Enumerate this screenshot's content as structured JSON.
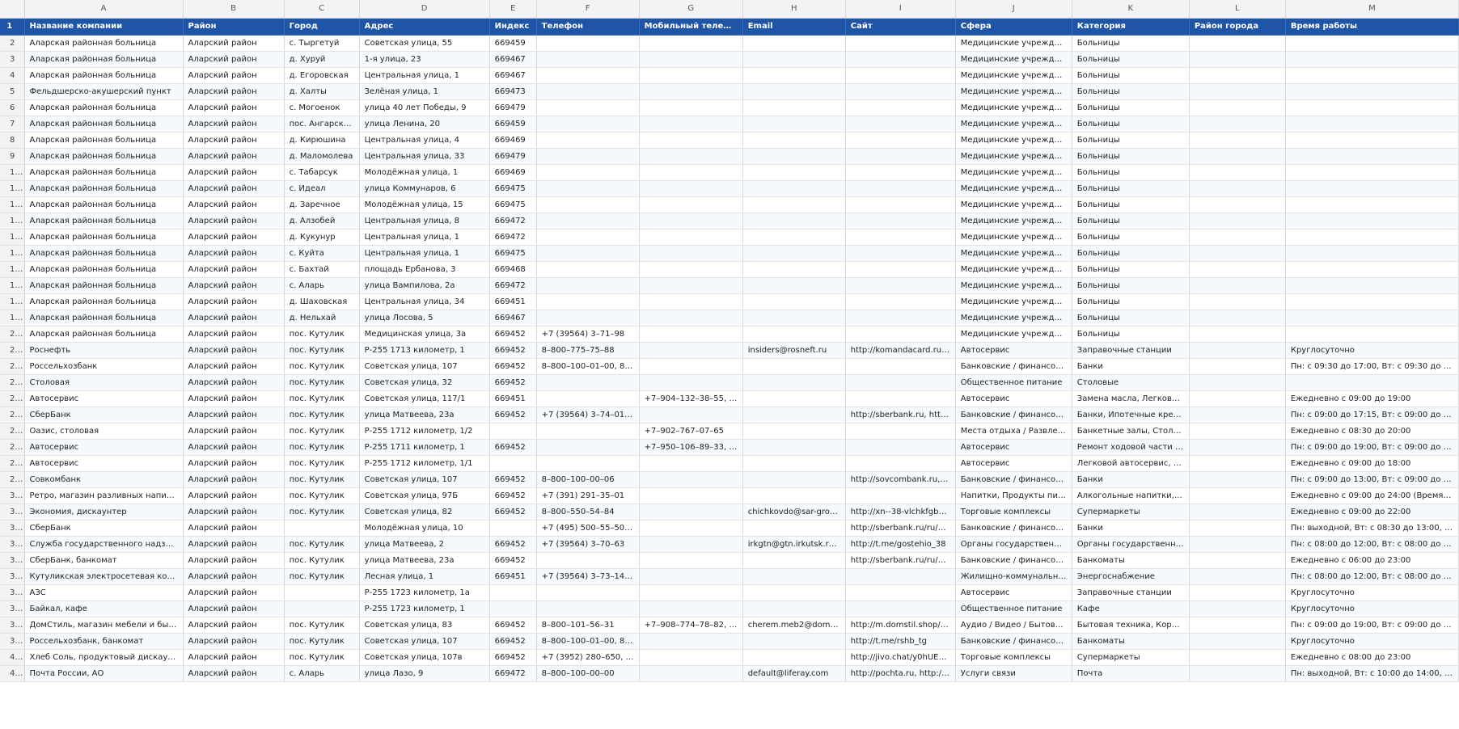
{
  "column_letters": [
    "A",
    "B",
    "C",
    "D",
    "E",
    "F",
    "G",
    "H",
    "I",
    "J",
    "K",
    "L",
    "M"
  ],
  "header_row_number": "1",
  "headers": [
    "Название компании",
    "Район",
    "Город",
    "Адрес",
    "Индекс",
    "Телефон",
    "Мобильный телефон",
    "Email",
    "Сайт",
    "Сфера",
    "Категория",
    "Район города",
    "Время работы"
  ],
  "rows": [
    [
      "2",
      "Аларская районная больница",
      "Аларский район",
      "с. Тыргетуй",
      "Советская улица, 55",
      "669459",
      "",
      "",
      "",
      "",
      "Медицинские учреждения",
      "Больницы",
      "",
      ""
    ],
    [
      "3",
      "Аларская районная больница",
      "Аларский район",
      "д. Хуруй",
      "1-я улица, 23",
      "669467",
      "",
      "",
      "",
      "",
      "Медицинские учреждения",
      "Больницы",
      "",
      ""
    ],
    [
      "4",
      "Аларская районная больница",
      "Аларский район",
      "д. Егоровская",
      "Центральная улица, 1",
      "669467",
      "",
      "",
      "",
      "",
      "Медицинские учреждения",
      "Больницы",
      "",
      ""
    ],
    [
      "5",
      "Фельдшерско-акушерский пункт",
      "Аларский район",
      "д. Халты",
      "Зелёная улица, 1",
      "669473",
      "",
      "",
      "",
      "",
      "Медицинские учреждения",
      "Больницы",
      "",
      ""
    ],
    [
      "6",
      "Аларская районная больница",
      "Аларский район",
      "с. Могоенок",
      "улица 40 лет Победы, 9",
      "669479",
      "",
      "",
      "",
      "",
      "Медицинские учреждения",
      "Больницы",
      "",
      ""
    ],
    [
      "7",
      "Аларская районная больница",
      "Аларский район",
      "пос. Ангарский",
      "улица Ленина, 20",
      "669459",
      "",
      "",
      "",
      "",
      "Медицинские учреждения",
      "Больницы",
      "",
      ""
    ],
    [
      "8",
      "Аларская районная больница",
      "Аларский район",
      "д. Кирюшина",
      "Центральная улица, 4",
      "669469",
      "",
      "",
      "",
      "",
      "Медицинские учреждения",
      "Больницы",
      "",
      ""
    ],
    [
      "9",
      "Аларская районная больница",
      "Аларский район",
      "д. Маломолева",
      "Центральная улица, 33",
      "669479",
      "",
      "",
      "",
      "",
      "Медицинские учреждения",
      "Больницы",
      "",
      ""
    ],
    [
      "10",
      "Аларская районная больница",
      "Аларский район",
      "с. Табарсук",
      "Молодёжная улица, 1",
      "669469",
      "",
      "",
      "",
      "",
      "Медицинские учреждения",
      "Больницы",
      "",
      ""
    ],
    [
      "11",
      "Аларская районная больница",
      "Аларский район",
      "с. Идеал",
      "улица Коммунаров, 6",
      "669475",
      "",
      "",
      "",
      "",
      "Медицинские учреждения",
      "Больницы",
      "",
      ""
    ],
    [
      "12",
      "Аларская районная больница",
      "Аларский район",
      "д. Заречное",
      "Молодёжная улица, 15",
      "669475",
      "",
      "",
      "",
      "",
      "Медицинские учреждения",
      "Больницы",
      "",
      ""
    ],
    [
      "13",
      "Аларская районная больница",
      "Аларский район",
      "д. Алзобей",
      "Центральная улица, 8",
      "669472",
      "",
      "",
      "",
      "",
      "Медицинские учреждения",
      "Больницы",
      "",
      ""
    ],
    [
      "14",
      "Аларская районная больница",
      "Аларский район",
      "д. Кукунур",
      "Центральная улица, 1",
      "669472",
      "",
      "",
      "",
      "",
      "Медицинские учреждения",
      "Больницы",
      "",
      ""
    ],
    [
      "15",
      "Аларская районная больница",
      "Аларский район",
      "с. Куйта",
      "Центральная улица, 1",
      "669475",
      "",
      "",
      "",
      "",
      "Медицинские учреждения",
      "Больницы",
      "",
      ""
    ],
    [
      "16",
      "Аларская районная больница",
      "Аларский район",
      "с. Бахтай",
      "площадь Ербанова, 3",
      "669468",
      "",
      "",
      "",
      "",
      "Медицинские учреждения",
      "Больницы",
      "",
      ""
    ],
    [
      "17",
      "Аларская районная больница",
      "Аларский район",
      "с. Аларь",
      "улица Вампилова, 2а",
      "669472",
      "",
      "",
      "",
      "",
      "Медицинские учреждения",
      "Больницы",
      "",
      ""
    ],
    [
      "18",
      "Аларская районная больница",
      "Аларский район",
      "д. Шаховская",
      "Центральная улица, 34",
      "669451",
      "",
      "",
      "",
      "",
      "Медицинские учреждения",
      "Больницы",
      "",
      ""
    ],
    [
      "19",
      "Аларская районная больница",
      "Аларский район",
      "д. Нельхай",
      "улица Лосова, 5",
      "669467",
      "",
      "",
      "",
      "",
      "Медицинские учреждения",
      "Больницы",
      "",
      ""
    ],
    [
      "20",
      "Аларская районная больница",
      "Аларский район",
      "пос. Кутулик",
      "Медицинская улица, 3а",
      "669452",
      "+7 (39564) 3–71–98",
      "",
      "",
      "",
      "Медицинские учреждения",
      "Больницы",
      "",
      ""
    ],
    [
      "21",
      "Роснефть",
      "Аларский район",
      "пос. Кутулик",
      "Р-255 1713 километр, 1",
      "669452",
      "8–800–775–75–88",
      "",
      "insiders@rosneft.ru",
      "http://komandacard.ru, ht...",
      "Автосервис",
      "Заправочные станции",
      "",
      "Круглосуточно"
    ],
    [
      "22",
      "Россельхозбанк",
      "Аларский район",
      "пос. Кутулик",
      "Советская улица, 107",
      "669452",
      "8–800–100–01–00, 8–8...",
      "",
      "",
      "",
      "Банковские / финансовые ...",
      "Банки",
      "",
      "Пн: с 09:30 до 17:00, Вт: с 09:30 до 17:00, С..."
    ],
    [
      "23",
      "Столовая",
      "Аларский район",
      "пос. Кутулик",
      "Советская улица, 32",
      "669452",
      "",
      "",
      "",
      "",
      "Общественное питание",
      "Столовые",
      "",
      ""
    ],
    [
      "24",
      "Автосервис",
      "Аларский район",
      "пос. Кутулик",
      "Советская улица, 117/1",
      "669451",
      "",
      "+7–904–132–38–55, +7...",
      "",
      "",
      "Автосервис",
      "Замена масла, Легковой а...",
      "",
      "Ежедневно с 09:00 до 19:00"
    ],
    [
      "25",
      "СберБанк",
      "Аларский район",
      "пос. Кутулик",
      "улица Матвеева, 23а",
      "669452",
      "+7 (39564) 3–74–01, 03...",
      "",
      "",
      "http://sberbank.ru, http://...",
      "Банковские / финансовые ...",
      "Банки, Ипотечные кредит...",
      "",
      "Пн: с 09:00 до 17:15, Вт: с 09:00 до 17:15, С..."
    ],
    [
      "26",
      "Оазис, столовая",
      "Аларский район",
      "пос. Кутулик",
      "Р-255 1712 километр, 1/2",
      "",
      "",
      "+7–902–767–07–65",
      "",
      "",
      "Места отдыха / Развлекате...",
      "Банкетные залы, Столовые",
      "",
      "Ежедневно с 08:30 до 20:00"
    ],
    [
      "27",
      "Автосервис",
      "Аларский район",
      "пос. Кутулик",
      "Р-255 1711 километр, 1",
      "669452",
      "",
      "+7–950–106–89–33, +7...",
      "",
      "",
      "Автосервис",
      "Ремонт ходовой части авт...",
      "",
      "Пн: с 09:00 до 19:00, Вт: с 09:00 до 19:00, С..."
    ],
    [
      "28",
      "Автосервис",
      "Аларский район",
      "пос. Кутулик",
      "Р-255 1712 километр, 1/1",
      "",
      "",
      "",
      "",
      "",
      "Автосервис",
      "Легковой автосервис, Рем...",
      "",
      "Ежедневно с 09:00 до 18:00"
    ],
    [
      "29",
      "Совкомбанк",
      "Аларский район",
      "пос. Кутулик",
      "Советская улица, 107",
      "669452",
      "8–800–100–00–06",
      "",
      "",
      "http://sovcombank.ru, htt...",
      "Банковские / финансовые ...",
      "Банки",
      "",
      "Пн: с 09:00 до 13:00, Вт: с 09:00 до 13:00, С..."
    ],
    [
      "30",
      "Ретро, магазин разливных напитков",
      "Аларский район",
      "пос. Кутулик",
      "Советская улица, 97Б",
      "669452",
      "+7 (391) 291–35–01",
      "",
      "",
      "",
      "Напитки, Продукты питания",
      "Алкогольные напитки, Без...",
      "",
      "Ежедневно с 09:00 до 24:00 (Время прода..."
    ],
    [
      "31",
      "Экономия, дискаунтер",
      "Аларский район",
      "пос. Кутулик",
      "Советская улица, 82",
      "669452",
      "8–800–550–54–84",
      "",
      "chichkovdo@sar-group....",
      "http://xn--38-vlchkfgb5k0...",
      "Торговые комплексы",
      "Супермаркеты",
      "",
      "Ежедневно с 09:00 до 22:00"
    ],
    [
      "32",
      "СберБанк",
      "Аларский район",
      "",
      "Молодёжная улица, 10",
      "",
      "+7 (495) 500–55–50, 8–...",
      "",
      "",
      "http://sberbank.ru/ru/quo...",
      "Банковские / финансовые ...",
      "Банки",
      "",
      "Пн: выходной, Вт: с 08:30 до 13:00, Ср: с 0..."
    ],
    [
      "33",
      "Служба государственного надзора за ...",
      "Аларский район",
      "пос. Кутулик",
      "улица Матвеева, 2",
      "669452",
      "+7 (39564) 3–70–63",
      "",
      "irkgtn@gtn.irkutsk.ru, m...",
      "http://t.me/gostehio_38",
      "Органы государственного ...",
      "Органы государственного ...",
      "",
      "Пн: с 08:00 до 12:00, Вт: с 08:00 до 12:00, С..."
    ],
    [
      "34",
      "СберБанк, банкомат",
      "Аларский район",
      "пос. Кутулик",
      "улица Матвеева, 23а",
      "669452",
      "",
      "",
      "",
      "http://sberbank.ru/ru/oib/...",
      "Банковские / финансовые ...",
      "Банкоматы",
      "",
      "Ежедневно с 06:00 до 23:00"
    ],
    [
      "35",
      "Кутуликская электросетевая компания",
      "Аларский район",
      "пос. Кутулик",
      "Лесная улица, 1",
      "669451",
      "+7 (39564) 3–73–14, +7...",
      "",
      "",
      "",
      "Жилищно-коммунальные ...",
      "Энергоснабжение",
      "",
      "Пн: с 08:00 до 12:00, Вт: с 08:00 до 12:00, С..."
    ],
    [
      "36",
      "АЗС",
      "Аларский район",
      "",
      "Р-255 1723 километр, 1а",
      "",
      "",
      "",
      "",
      "",
      "Автосервис",
      "Заправочные станции",
      "",
      "Круглосуточно"
    ],
    [
      "37",
      "Байкал, кафе",
      "Аларский район",
      "",
      "Р-255 1723 километр, 1",
      "",
      "",
      "",
      "",
      "",
      "Общественное питание",
      "Кафе",
      "",
      "Круглосуточно"
    ],
    [
      "38",
      "ДомСтиль, магазин мебели и бытово...",
      "Аларский район",
      "пос. Кутулик",
      "Советская улица, 83",
      "669452",
      "8–800–101–56–31",
      "+7–908–774–78–82, +7...",
      "cherem.meb2@domstil....",
      "http://m.domstil.shop/, ht...",
      "Аудио / Видео / Бытовая т...",
      "Бытовая техника, Корпусн...",
      "",
      "Пн: с 09:00 до 19:00, Вт: с 09:00 до 19:00, С..."
    ],
    [
      "39",
      "Россельхозбанк, банкомат",
      "Аларский район",
      "пос. Кутулик",
      "Советская улица, 107",
      "669452",
      "8–800–100–01–00, 8–8...",
      "",
      "",
      "http://t.me/rshb_tg",
      "Банковские / финансовые ...",
      "Банкоматы",
      "",
      "Круглосуточно"
    ],
    [
      "40",
      "Хлеб Соль, продуктовый дискаунтер",
      "Аларский район",
      "пос. Кутулик",
      "Советская улица, 107в",
      "669452",
      "+7 (3952) 280–650, +7 (...",
      "",
      "",
      "http://jivo.chat/y0hUEwOJ...",
      "Торговые комплексы",
      "Супермаркеты",
      "",
      "Ежедневно с 08:00 до 23:00"
    ],
    [
      "41",
      "Почта России, АО",
      "Аларский район",
      "с. Аларь",
      "улица Лазо, 9",
      "669472",
      "8–800–100–00–00",
      "",
      "default@liferay.com",
      "http://pochta.ru, http://po...",
      "Услуги связи",
      "Почта",
      "",
      "Пн: выходной, Вт: с 10:00 до 14:00, Ср: с 1..."
    ]
  ]
}
